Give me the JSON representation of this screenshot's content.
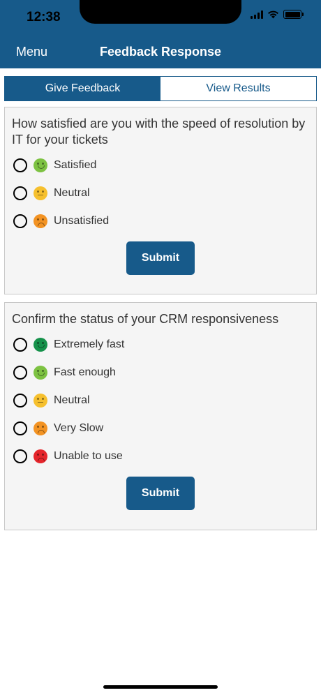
{
  "status_bar": {
    "time": "12:38",
    "icons": [
      "signal-icon",
      "wifi-icon",
      "battery-icon"
    ]
  },
  "nav": {
    "menu_label": "Menu",
    "title": "Feedback Response"
  },
  "tabs": [
    {
      "label": "Give Feedback",
      "active": true
    },
    {
      "label": "View Results",
      "active": false
    }
  ],
  "surveys": [
    {
      "question": "How satisfied are you with the speed of resolution by IT for your tickets",
      "options": [
        {
          "label": "Satisfied",
          "icon": "satisfied-emoji-icon",
          "color": "#7dc242"
        },
        {
          "label": "Neutral",
          "icon": "neutral-emoji-icon",
          "color": "#f6c02e"
        },
        {
          "label": "Unsatisfied",
          "icon": "unsatisfied-emoji-icon",
          "color": "#f39323"
        }
      ],
      "submit_label": "Submit"
    },
    {
      "question": "Confirm the status of your CRM responsiveness",
      "options": [
        {
          "label": "Extremely fast",
          "icon": "very-happy-emoji-icon",
          "color": "#15914a"
        },
        {
          "label": "Fast enough",
          "icon": "happy-emoji-icon",
          "color": "#7dc242"
        },
        {
          "label": "Neutral",
          "icon": "neutral-emoji-icon",
          "color": "#f6c02e"
        },
        {
          "label": "Very Slow",
          "icon": "unhappy-emoji-icon",
          "color": "#f39323"
        },
        {
          "label": "Unable to use",
          "icon": "very-unhappy-emoji-icon",
          "color": "#e5252b"
        }
      ],
      "submit_label": "Submit"
    }
  ],
  "colors": {
    "brand": "#175a8a",
    "card_bg": "#f5f5f5"
  }
}
